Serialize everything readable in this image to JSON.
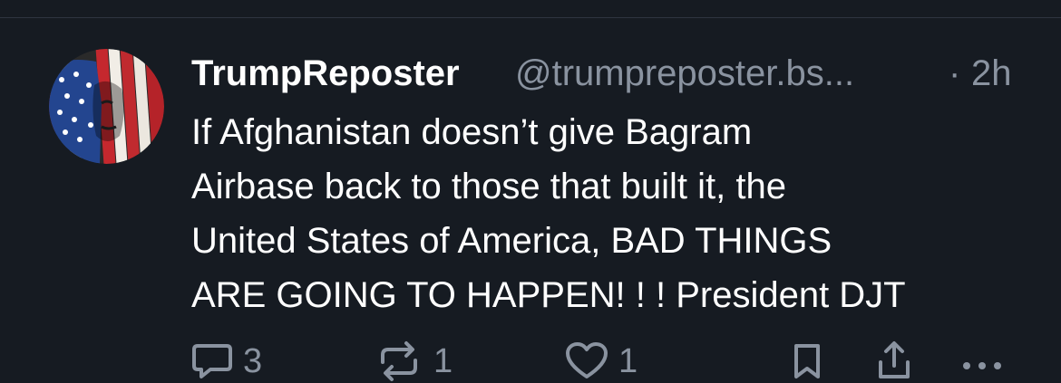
{
  "post": {
    "author": {
      "display_name": "TrumpReposter",
      "handle": "@trumpreposter.bs...",
      "avatar_icon": "american-flag-portrait-avatar"
    },
    "separator": "·",
    "time": "2h",
    "text": "If Afghanistan doesn’t give Bagram\nAirbase back to those that built it, the\nUnited States of America, BAD THINGS\nARE GOING TO HAPPEN! ! ! President DJT",
    "actions": {
      "reply": {
        "icon": "reply-bubble-icon",
        "count": "3"
      },
      "repost": {
        "icon": "repost-icon",
        "count": "1"
      },
      "like": {
        "icon": "heart-icon",
        "count": "1"
      },
      "bookmark": {
        "icon": "bookmark-icon"
      },
      "share": {
        "icon": "share-icon"
      },
      "more": {
        "icon": "more-horizontal-icon"
      }
    }
  },
  "colors": {
    "background": "#161b22",
    "text": "#ffffff",
    "muted": "#8a93a0",
    "divider": "#2e3541"
  }
}
